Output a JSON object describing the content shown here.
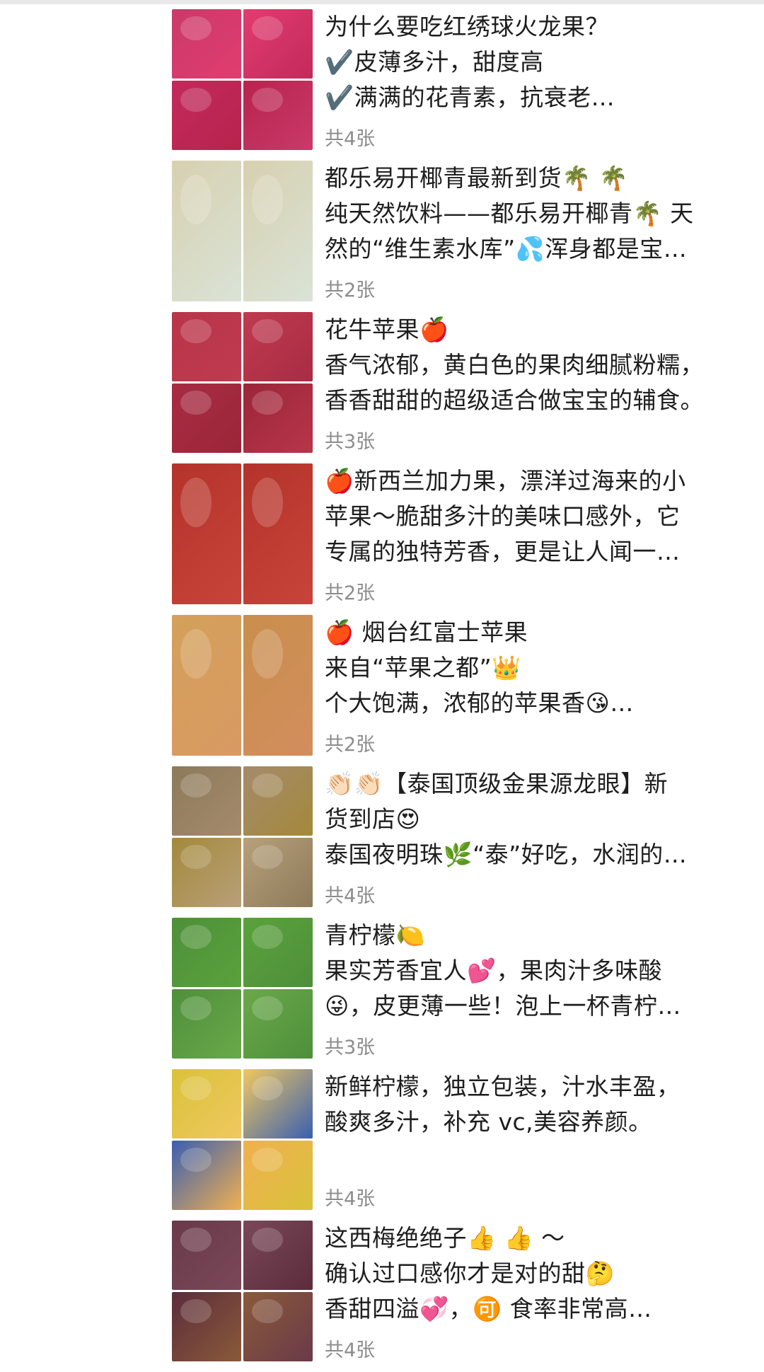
{
  "posts": [
    {
      "lines": [],
      "count": "共4张",
      "thumb_colors": [
        "#d9b23a",
        "#6f5a2a",
        "#c9a54a",
        "#8a7a4a"
      ]
    },
    {
      "lines": [
        "为什么要吃红绣球火龙果？",
        "✔️皮薄多汁，甜度高",
        "✔️满满的花青素，抗衰老…"
      ],
      "count": "共4张",
      "thumb_colors": [
        "#c93a6a",
        "#e23c6f",
        "#c22a5c",
        "#b8234d"
      ]
    },
    {
      "lines": [
        "都乐易开椰青最新到货🌴 🌴",
        "纯天然饮料——都乐易开椰青🌴 天",
        "然的“维生素水库”💦浑身都是宝…"
      ],
      "count": "共2张",
      "thumb_colors": [
        "#d8d0b0",
        "#d9e3d6",
        "#d8d0b0",
        "#d9e3d6"
      ]
    },
    {
      "lines": [
        "花牛苹果🍎",
        "香气浓郁，黄白色的果肉细腻粉糯，",
        "香香甜甜的超级适合做宝宝的辅食。"
      ],
      "count": "共3张",
      "thumb_colors": [
        "#b8354a",
        "#c03a4f",
        "#a82c44",
        "#9b2638"
      ]
    },
    {
      "lines": [
        "🍎新西兰加力果，漂洋过海来的小",
        "苹果～脆甜多汁的美味口感外，它",
        "专属的独特芳香，更是让人闻一…"
      ],
      "count": "共2张",
      "thumb_colors": [
        "#b4332a",
        "#c7443a",
        "#b4332a",
        "#c7443a"
      ]
    },
    {
      "lines": [
        "🍎 烟台红富士苹果",
        "来自“苹果之都”👑",
        "个大饱满，浓郁的苹果香😘…"
      ],
      "count": "共2张",
      "thumb_colors": [
        "#d4a05a",
        "#d89a63",
        "#c98f4c",
        "#d28d5e"
      ]
    },
    {
      "lines": [
        "👏🏻👏🏻【泰国顶级金果源龙眼】新",
        "货到店😍",
        "泰国夜明珠🌿“泰”好吃，水润的…"
      ],
      "count": "共4张",
      "thumb_colors": [
        "#8c7a5a",
        "#a58a6c",
        "#a4893a",
        "#b8a07a"
      ]
    },
    {
      "lines": [
        "青柠檬🍋",
        "果实芳香宜人💕，果肉汁多味酸",
        "😜，皮更薄一些！泡上一杯青柠…"
      ],
      "count": "共3张",
      "thumb_colors": [
        "#4e8f3a",
        "#5aa23c",
        "#4e8f3a",
        "#6aa84a"
      ]
    },
    {
      "lines": [
        "新鲜柠檬，独立包装，汁水丰盈，",
        "酸爽多汁，补充 vc,美容养颜。"
      ],
      "count": "共4张",
      "thumb_colors": [
        "#d9c23a",
        "#f0c860",
        "#3a5fb0",
        "#f0b050"
      ]
    },
    {
      "lines": [
        "这西梅绝绝子👍 👍 ～",
        "确认过口感你才是对的甜🤔",
        "香甜四溢💞，🉑 食率非常高…"
      ],
      "count": "共4张",
      "thumb_colors": [
        "#6a3a4a",
        "#7a4858",
        "#5c2c3c",
        "#8a5a3a"
      ]
    }
  ]
}
